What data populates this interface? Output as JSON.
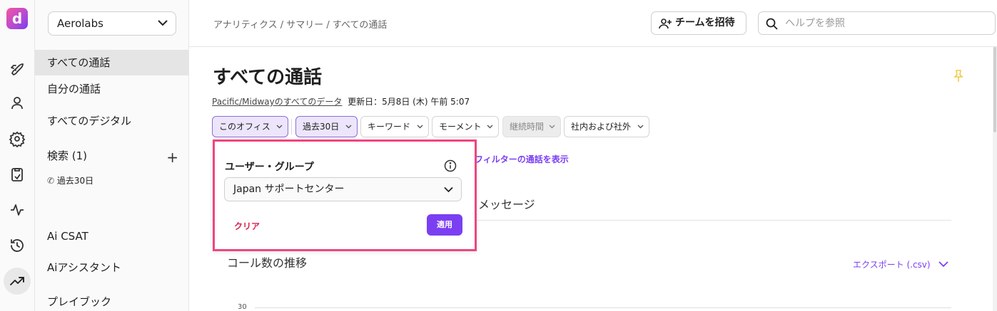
{
  "brand": {
    "logo_glyph": "d",
    "accent": "#7b3ff2",
    "highlight_border": "#f0457f"
  },
  "rail": {
    "icons": [
      "rocket-icon",
      "user-icon",
      "gear-icon",
      "clipboard-icon",
      "activity-icon",
      "history-icon",
      "trending-icon"
    ],
    "active": "trending-icon"
  },
  "sidebar": {
    "org_name": "Aerolabs",
    "items": [
      {
        "label": "すべての通話",
        "active": true
      },
      {
        "label": "自分の通話"
      },
      {
        "label": "すべてのデジタル"
      }
    ],
    "search_section": {
      "label": "検索 (1)",
      "sub_item": "過去30日"
    },
    "items_bottom": [
      {
        "label": "Ai CSAT"
      },
      {
        "label": "Aiアシスタント"
      },
      {
        "label": "プレイブック"
      }
    ]
  },
  "header": {
    "breadcrumb": "アナリティクス / サマリー / すべての通話",
    "invite_label": "チームを招待",
    "search_placeholder": "ヘルプを参照"
  },
  "main": {
    "title": "すべての通話",
    "timezone_text": "Pacific/Midwayのすべてのデータ",
    "updated_text": "更新日：5月8日 (木) 午前 5:07",
    "filters": [
      {
        "label": "このオフィス",
        "state": "selected"
      },
      {
        "label": "過去30日",
        "state": "selected"
      },
      {
        "label": "キーワード",
        "state": "default"
      },
      {
        "label": "モーメント",
        "state": "default"
      },
      {
        "label": "継続時間",
        "state": "disabled"
      },
      {
        "label": "社内および社外",
        "state": "default"
      }
    ],
    "partial_link": "フィルターの通話を表示",
    "partial_tab": "メッセージ",
    "chart_title": "コール数の推移",
    "export_label": "エクスポート (.csv)",
    "y_tick_top": "30"
  },
  "popover": {
    "title": "ユーザー・グループ",
    "selected_group": "Japan サポートセンター",
    "clear_label": "クリア",
    "apply_label": "適用"
  }
}
